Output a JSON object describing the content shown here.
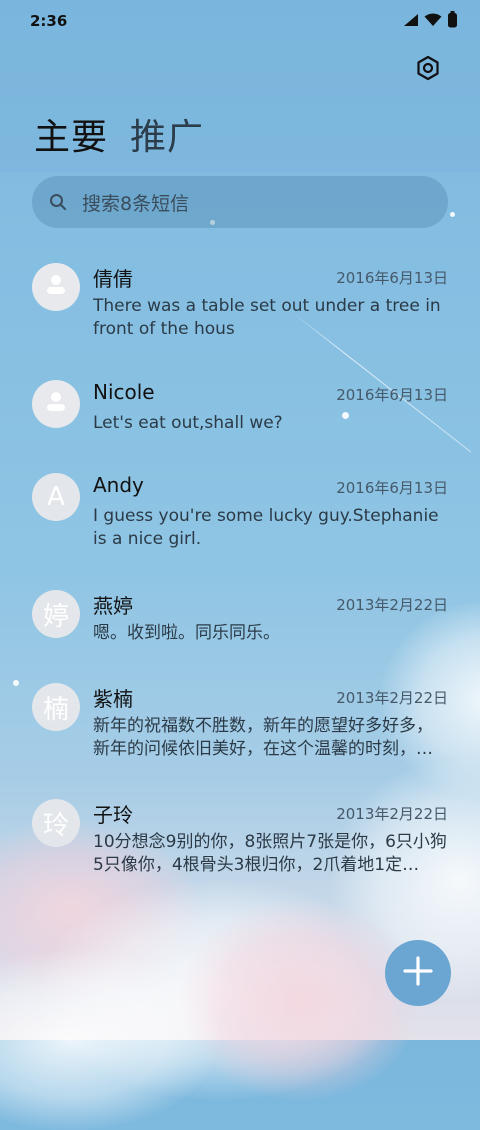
{
  "status_bar": {
    "time": "2:36"
  },
  "tabs": [
    {
      "label": "主要",
      "active": true
    },
    {
      "label": "推广",
      "active": false
    }
  ],
  "search": {
    "placeholder": "搜索8条短信"
  },
  "conversations": [
    {
      "name": "倩倩",
      "avatar_type": "person-icon",
      "avatar_text": "",
      "date": "2016年6月13日",
      "preview": "There was a table set out under a tree in front of the hous"
    },
    {
      "name": "Nicole",
      "avatar_type": "person-icon",
      "avatar_text": "",
      "date": "2016年6月13日",
      "preview": "Let's eat out,shall we?"
    },
    {
      "name": "Andy",
      "avatar_type": "letter",
      "avatar_text": "A",
      "date": "2016年6月13日",
      "preview": "I guess you're some lucky guy.Stephanie is a nice girl."
    },
    {
      "name": "燕婷",
      "avatar_type": "letter",
      "avatar_text": "婷",
      "date": "2013年2月22日",
      "preview": "嗯。收到啦。同乐同乐。"
    },
    {
      "name": "紫楠",
      "avatar_type": "letter",
      "avatar_text": "楠",
      "date": "2013年2月22日",
      "preview": "新年的祝福数不胜数，新年的愿望好多好多，新年的问候依旧美好，在这个温馨的时刻，…"
    },
    {
      "name": "子玲",
      "avatar_type": "letter",
      "avatar_text": "玲",
      "date": "2013年2月22日",
      "preview": "10分想念9别的你，8张照片7张是你，6只小狗5只像你，4根骨头3根归你，2爪着地1定…"
    }
  ],
  "fab": {
    "icon": "plus-icon"
  },
  "colors": {
    "fab": "#6ba6d2",
    "search_bg": "#4880a8"
  }
}
